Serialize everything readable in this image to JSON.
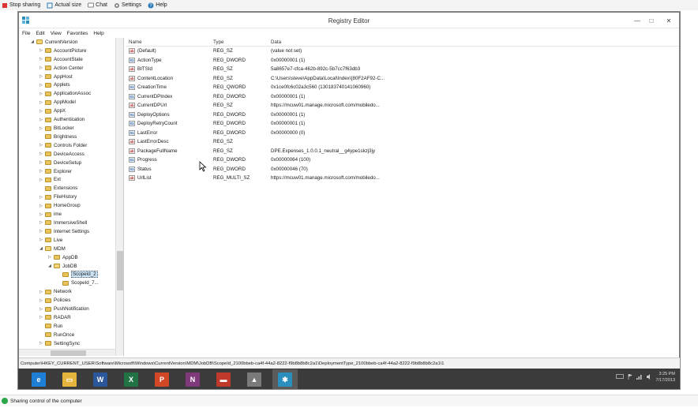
{
  "share_bar": {
    "stop_label": "Stop sharing",
    "actual_label": "Actual size",
    "chat_label": "Chat",
    "settings_label": "Settings",
    "help_label": "Help"
  },
  "window": {
    "title": "Registry Editor",
    "controls": {
      "minimize": "—",
      "maximize": "□",
      "close": "✕"
    },
    "menu": [
      "File",
      "Edit",
      "View",
      "Favorites",
      "Help"
    ]
  },
  "tree": {
    "items": [
      {
        "label": "CurrentVersion",
        "exp": "◢",
        "open": true,
        "indent": 1
      },
      {
        "label": "AccountPicture",
        "exp": "▷",
        "indent": 2
      },
      {
        "label": "AccountState",
        "exp": "▷",
        "indent": 2
      },
      {
        "label": "Action Center",
        "exp": "▷",
        "indent": 2
      },
      {
        "label": "AppHost",
        "exp": "▷",
        "indent": 2
      },
      {
        "label": "Applets",
        "exp": "▷",
        "indent": 2
      },
      {
        "label": "ApplicationAssoc",
        "exp": "▷",
        "indent": 2
      },
      {
        "label": "AppModel",
        "exp": "▷",
        "indent": 2
      },
      {
        "label": "AppX",
        "exp": "▷",
        "indent": 2
      },
      {
        "label": "Authentication",
        "exp": "▷",
        "indent": 2
      },
      {
        "label": "BitLocker",
        "exp": "▷",
        "indent": 2
      },
      {
        "label": "Brightness",
        "exp": "",
        "indent": 2
      },
      {
        "label": "Controls Folder",
        "exp": "▷",
        "indent": 2
      },
      {
        "label": "DeviceAccess",
        "exp": "▷",
        "indent": 2
      },
      {
        "label": "DeviceSetup",
        "exp": "▷",
        "indent": 2
      },
      {
        "label": "Explorer",
        "exp": "▷",
        "indent": 2
      },
      {
        "label": "Ext",
        "exp": "▷",
        "indent": 2
      },
      {
        "label": "Extensions",
        "exp": "",
        "indent": 2
      },
      {
        "label": "FileHistory",
        "exp": "▷",
        "indent": 2
      },
      {
        "label": "HomeGroup",
        "exp": "▷",
        "indent": 2
      },
      {
        "label": "ime",
        "exp": "▷",
        "indent": 2
      },
      {
        "label": "ImmersiveShell",
        "exp": "▷",
        "indent": 2
      },
      {
        "label": "Internet Settings",
        "exp": "▷",
        "indent": 2
      },
      {
        "label": "Live",
        "exp": "▷",
        "indent": 2
      },
      {
        "label": "MDM",
        "exp": "◢",
        "open": true,
        "indent": 2
      },
      {
        "label": "AppDB",
        "exp": "▷",
        "indent": 3
      },
      {
        "label": "JobDB",
        "exp": "◢",
        "open": true,
        "indent": 3
      },
      {
        "label": "ScopeId_2",
        "exp": "",
        "indent": 4,
        "selected": true
      },
      {
        "label": "ScopeId_7...",
        "exp": "",
        "indent": 4
      },
      {
        "label": "Network",
        "exp": "▷",
        "indent": 2
      },
      {
        "label": "Policies",
        "exp": "▷",
        "indent": 2
      },
      {
        "label": "PushNotification",
        "exp": "▷",
        "indent": 2
      },
      {
        "label": "RADAR",
        "exp": "▷",
        "indent": 2
      },
      {
        "label": "Run",
        "exp": "",
        "indent": 2
      },
      {
        "label": "RunOnce",
        "exp": "",
        "indent": 2
      },
      {
        "label": "SettingSync",
        "exp": "▷",
        "indent": 2
      }
    ]
  },
  "values": {
    "headers": {
      "name": "Name",
      "type": "Type",
      "data": "Data"
    },
    "rows": [
      {
        "icon": "ab",
        "name": "(Default)",
        "type": "REG_SZ",
        "data": "(value not set)"
      },
      {
        "icon": "bin",
        "name": "ActionType",
        "type": "REG_DWORD",
        "data": "0x00000001 (1)"
      },
      {
        "icon": "ab",
        "name": "BITSId",
        "type": "REG_SZ",
        "data": "5a8657e7-cfca-462b-892c-5b7cc7f63db3"
      },
      {
        "icon": "ab",
        "name": "ContentLocation",
        "type": "REG_SZ",
        "data": "C:\\Users\\steve\\AppData\\Local\\Index\\{80F2AF92-C..."
      },
      {
        "icon": "bin",
        "name": "CreationTime",
        "type": "REG_QWORD",
        "data": "0x1ce0fc6c02a3c560 (130183740141060960)"
      },
      {
        "icon": "bin",
        "name": "CurrentDPIndex",
        "type": "REG_DWORD",
        "data": "0x00000001 (1)"
      },
      {
        "icon": "ab",
        "name": "CurrentDPUrl",
        "type": "REG_SZ",
        "data": "https://mcuw01.manage.microsoft.com/mobiledo..."
      },
      {
        "icon": "bin",
        "name": "DeployOptions",
        "type": "REG_DWORD",
        "data": "0x00000001 (1)"
      },
      {
        "icon": "bin",
        "name": "DeployRetryCount",
        "type": "REG_DWORD",
        "data": "0x00000001 (1)"
      },
      {
        "icon": "bin",
        "name": "LastError",
        "type": "REG_DWORD",
        "data": "0x00000000 (0)"
      },
      {
        "icon": "ab",
        "name": "LastErrorDesc",
        "type": "REG_SZ",
        "data": ""
      },
      {
        "icon": "ab",
        "name": "PackageFullName",
        "type": "REG_SZ",
        "data": "DPE.Expenses_1.0.0.1_neutral__g4ype1skzj3jy"
      },
      {
        "icon": "bin",
        "name": "Progress",
        "type": "REG_DWORD",
        "data": "0x00000064 (100)"
      },
      {
        "icon": "bin",
        "name": "Status",
        "type": "REG_DWORD",
        "data": "0x00000046 (70)"
      },
      {
        "icon": "ab",
        "name": "UrlList",
        "type": "REG_MULTI_SZ",
        "data": "https://mcuw01.manage.microsoft.com/mobiledo..."
      }
    ]
  },
  "status_path": "Computer\\HKEY_CURRENT_USER\\Software\\Microsoft\\Windows\\CurrentVersion\\MDM\\JobDB\\ScopeId_2100bbeb-ca4f-44a2-8222-f9b8b8b8c2a1\\DeploymentType_2100bbeb-ca4f-44a2-8222-f9b8b8b8c2a1\\1",
  "taskbar": {
    "apps": [
      {
        "name": "ie",
        "glyph": "e",
        "color": "#1e7fd6"
      },
      {
        "name": "explorer",
        "glyph": "▭",
        "color": "#e4b43c"
      },
      {
        "name": "word",
        "glyph": "W",
        "color": "#2b579a"
      },
      {
        "name": "excel",
        "glyph": "X",
        "color": "#217346"
      },
      {
        "name": "powerpoint",
        "glyph": "P",
        "color": "#d24726"
      },
      {
        "name": "onenote",
        "glyph": "N",
        "color": "#80397b"
      },
      {
        "name": "briefcase",
        "glyph": "▬",
        "color": "#c0392b"
      },
      {
        "name": "wizard",
        "glyph": "▲",
        "color": "#7a7a7a"
      },
      {
        "name": "regedit",
        "glyph": "✱",
        "color": "#2a8fbd"
      }
    ],
    "time": "3:25 PM",
    "date": "7/17/2013"
  },
  "bottom_status": "Sharing control of the computer",
  "colors": {
    "accent": "#2aa84a",
    "folder": "#e8c45a",
    "taskbar": "#3b3b3b"
  }
}
